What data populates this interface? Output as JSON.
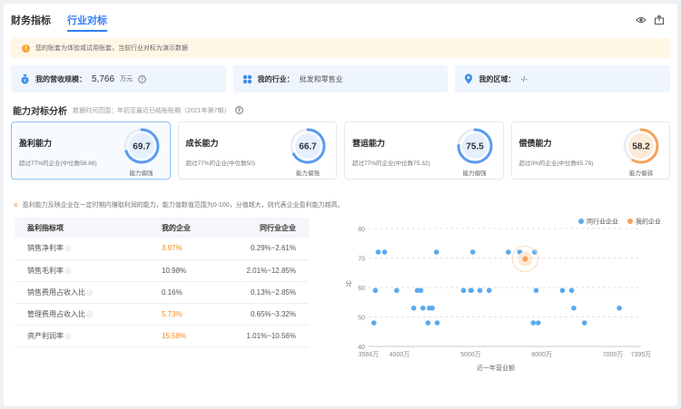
{
  "tabs": [
    {
      "label": "财务指标",
      "active": false
    },
    {
      "label": "行业对标",
      "active": true
    }
  ],
  "notice": {
    "text": "您的账套为体验或试用账套，当前行业对标为演示数据"
  },
  "info": {
    "revenue_label": "我的营收规模：",
    "revenue_value": "5,766",
    "revenue_unit": "万元",
    "industry_label": "我的行业：",
    "industry_value": "批发和零售业",
    "region_label": "我的区域：",
    "region_value": "-/-"
  },
  "section": {
    "title": "能力对标分析",
    "subtitle": "数据时间范围：年初至最近已结账账期（2021年第7期）"
  },
  "cards": [
    {
      "title": "盈利能力",
      "desc": "超过77%的企业(中位数58.88)",
      "score": "69.7",
      "score_num": 69.7,
      "level": "能力偏强",
      "color": "#5b9bef",
      "active": true
    },
    {
      "title": "成长能力",
      "desc": "超过77%的企业(中位数50)",
      "score": "66.7",
      "score_num": 66.7,
      "level": "能力偏强",
      "color": "#5b9bef",
      "active": false
    },
    {
      "title": "营运能力",
      "desc": "超过77%的企业(中位数75.32)",
      "score": "75.5",
      "score_num": 75.5,
      "level": "能力偏强",
      "color": "#5b9bef",
      "active": false
    },
    {
      "title": "偿债能力",
      "desc": "超过0%的企业(中位数65.79)",
      "score": "58.2",
      "score_num": 58.2,
      "level": "能力偏弱",
      "color": "#f5a35b",
      "active": false
    }
  ],
  "desc_line": "盈利能力反映企业在一定时期内赚取利润的能力，能力值数值范围为0-100，分值越大，则代表企业盈利能力越高。",
  "table": {
    "headers": [
      "盈利指标项",
      "我的企业",
      "同行业企业"
    ],
    "rows": [
      {
        "name": "销售净利率",
        "mine": "3.97%",
        "peer": "0.29%~2.61%",
        "highlight": true
      },
      {
        "name": "销售毛利率",
        "mine": "10.98%",
        "peer": "2.01%~12.85%",
        "highlight": false
      },
      {
        "name": "销售费用占收入比",
        "mine": "0.16%",
        "peer": "0.13%~2.85%",
        "highlight": false
      },
      {
        "name": "管理费用占收入比",
        "mine": "5.73%",
        "peer": "0.65%~3.32%",
        "highlight": true
      },
      {
        "name": "资产利润率",
        "mine": "15.58%",
        "peer": "1.01%~10.56%",
        "highlight": true
      }
    ]
  },
  "chart_data": {
    "type": "scatter",
    "xlabel": "近一年营业额",
    "ylabel": "分",
    "ylim": [
      40,
      80
    ],
    "yticks": [
      "40",
      "50",
      "60",
      "70",
      "80"
    ],
    "xlim": [
      3566,
      7395
    ],
    "xticks": [
      {
        "v": 3566,
        "label": "3566万"
      },
      {
        "v": 4000,
        "label": "4000万"
      },
      {
        "v": 5000,
        "label": "5000万"
      },
      {
        "v": 6000,
        "label": "6000万"
      },
      {
        "v": 7000,
        "label": "7000万"
      },
      {
        "v": 7395,
        "label": "7395万"
      }
    ],
    "legend": [
      {
        "name": "同行业企业",
        "color": "#5aa9ee"
      },
      {
        "name": "我的企业",
        "color": "#f5a35b"
      }
    ],
    "series": [
      {
        "name": "同行业企业",
        "color": "#5aa9ee",
        "points": [
          [
            3640,
            48
          ],
          [
            3660,
            59
          ],
          [
            3700,
            72
          ],
          [
            3790,
            72
          ],
          [
            3960,
            59
          ],
          [
            4200,
            53
          ],
          [
            4250,
            59
          ],
          [
            4300,
            59
          ],
          [
            4330,
            53
          ],
          [
            4400,
            48
          ],
          [
            4420,
            53
          ],
          [
            4460,
            53
          ],
          [
            4520,
            72
          ],
          [
            4530,
            48
          ],
          [
            4900,
            59
          ],
          [
            5000,
            59
          ],
          [
            5010,
            59
          ],
          [
            5030,
            72
          ],
          [
            5130,
            59
          ],
          [
            5260,
            59
          ],
          [
            5530,
            72
          ],
          [
            5690,
            72
          ],
          [
            5880,
            48
          ],
          [
            5900,
            72
          ],
          [
            5920,
            59
          ],
          [
            5950,
            48
          ],
          [
            6290,
            59
          ],
          [
            6420,
            59
          ],
          [
            6450,
            53
          ],
          [
            6600,
            48
          ],
          [
            7090,
            53
          ]
        ]
      },
      {
        "name": "我的企业",
        "color": "#f5a35b",
        "points": [
          [
            5766,
            69.7
          ]
        ]
      }
    ]
  }
}
